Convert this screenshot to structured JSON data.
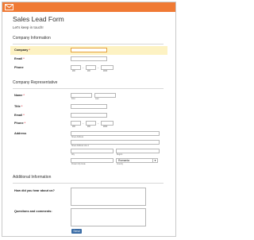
{
  "header": {
    "title": "Sales Lead Form",
    "subtitle": "Let's keep in touch!"
  },
  "sections": {
    "company": "Company Information",
    "rep": "Company Representative",
    "additional": "Additional Information"
  },
  "fields": {
    "company": "Company",
    "email": "Email",
    "phone": "Phone",
    "name": "Name",
    "title": "Title",
    "rep_email": "Email",
    "rep_phone": "Phone",
    "address": "Address",
    "hear": "How did you hear about us?",
    "questions": "Questions and comments:"
  },
  "required_mark": "*",
  "sublabels": {
    "phone_area": "###",
    "phone_prefix": "###",
    "phone_line": "####",
    "first": "First",
    "last": "Last",
    "street": "Street Address",
    "street2": "Street Address Line 2",
    "city": "City",
    "state": "Region",
    "zip": "Postal / Zip Code",
    "country": "Country"
  },
  "dash": "-",
  "country_value": "Romania",
  "submit_label": "Send",
  "colors": {
    "topbar": "#f07a34",
    "highlight": "#fdf2c3",
    "button": "#3b6da6"
  },
  "icons": {
    "topbar": "envelope-icon"
  }
}
